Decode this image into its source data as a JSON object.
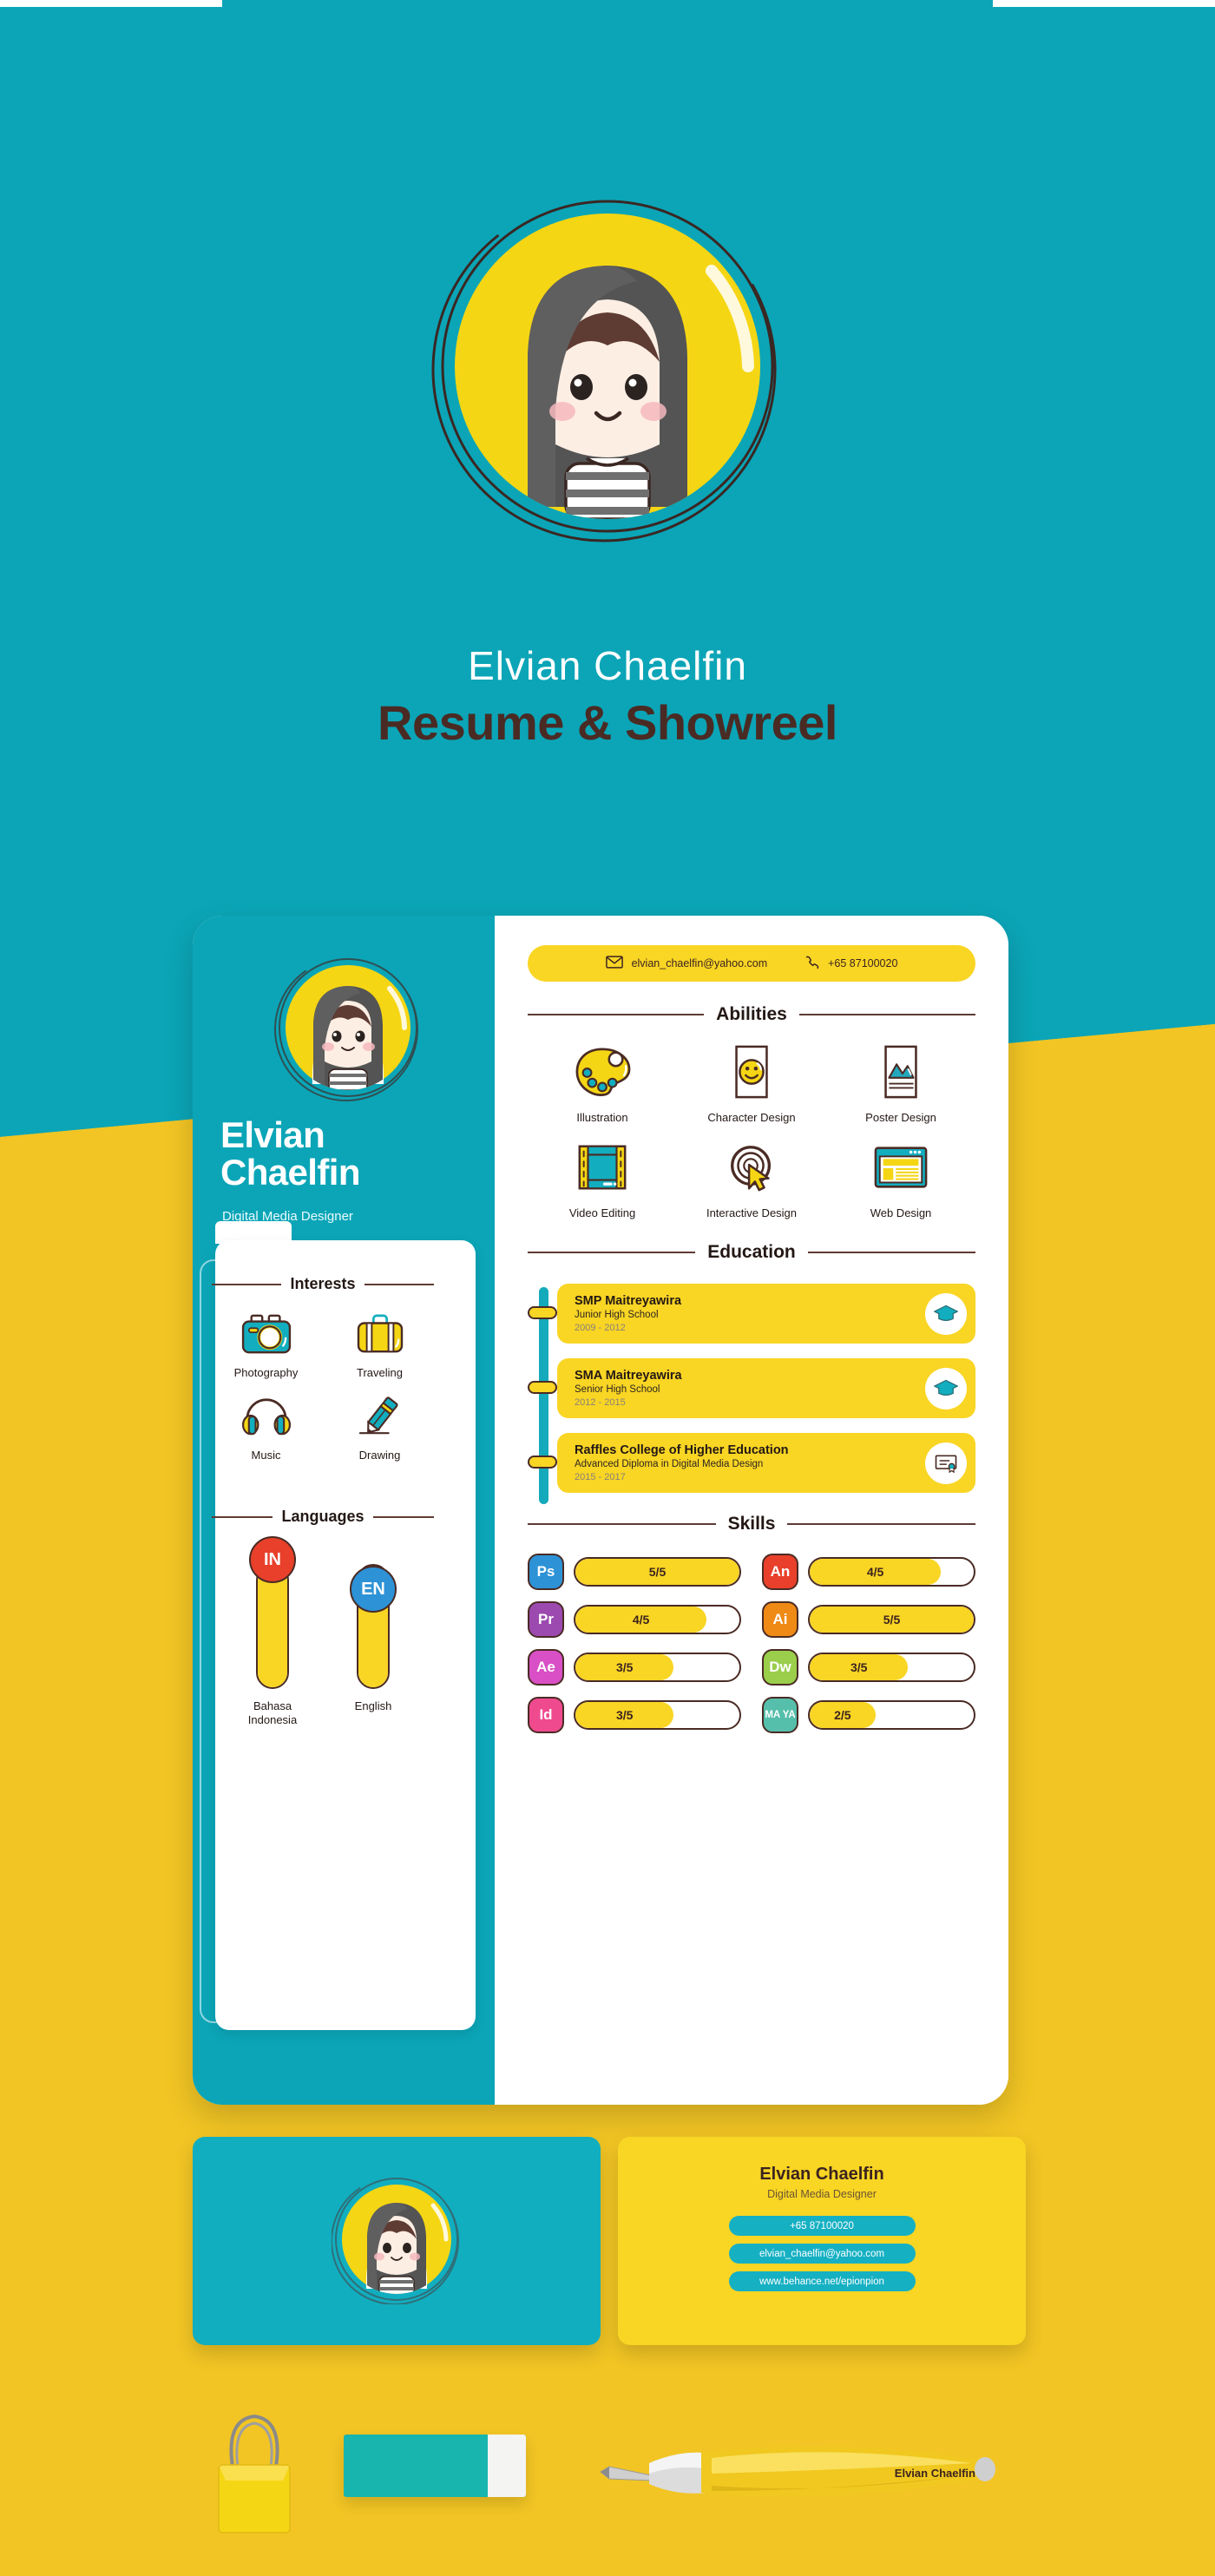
{
  "theme": {
    "teal": "#0ba5b7",
    "yellow": "#f2c524",
    "bright_yellow": "#f9d524",
    "dark_brown": "#4a2b24",
    "white": "#ffffff"
  },
  "hero": {
    "name": "Elvian Chaelfin",
    "title": "Resume & Showreel",
    "avatar_icon": "girl-avatar-icon"
  },
  "resume": {
    "sidebar": {
      "avatar_icon": "girl-avatar-icon",
      "name_line1": "Elvian",
      "name_line2": "Chaelfin",
      "role": "Digital Media Designer",
      "interests": {
        "heading": "Interests",
        "items": [
          {
            "label": "Photography",
            "icon": "camera-icon"
          },
          {
            "label": "Traveling",
            "icon": "suitcase-icon"
          },
          {
            "label": "Music",
            "icon": "headphones-icon"
          },
          {
            "label": "Drawing",
            "icon": "pencil-icon"
          }
        ]
      },
      "languages": {
        "heading": "Languages",
        "items": [
          {
            "code": "IN",
            "name": "Bahasa Indonesia",
            "level": 100,
            "badge_color": "#e8402a"
          },
          {
            "code": "EN",
            "name": "English",
            "level": 78,
            "badge_color": "#2d92d6"
          }
        ]
      }
    },
    "contact": {
      "email": "elvian_chaelfin@yahoo.com",
      "phone": "+65 87100020",
      "email_icon": "envelope-icon",
      "phone_icon": "phone-icon"
    },
    "abilities": {
      "heading": "Abilities",
      "items": [
        {
          "label": "Illustration",
          "icon": "palette-icon"
        },
        {
          "label": "Character Design",
          "icon": "smiley-page-icon"
        },
        {
          "label": "Poster Design",
          "icon": "poster-icon"
        },
        {
          "label": "Video Editing",
          "icon": "film-strip-icon"
        },
        {
          "label": "Interactive Design",
          "icon": "cursor-click-icon"
        },
        {
          "label": "Web Design",
          "icon": "browser-window-icon"
        }
      ]
    },
    "education": {
      "heading": "Education",
      "items": [
        {
          "school": "SMP Maitreyawira",
          "detail": "Junior High School",
          "years": "2009 - 2012",
          "icon": "graduation-cap-icon"
        },
        {
          "school": "SMA Maitreyawira",
          "detail": "Senior High School",
          "years": "2012 - 2015",
          "icon": "graduation-cap-icon"
        },
        {
          "school": "Raffles College of Higher Education",
          "detail": "Advanced Diploma in Digital Media Design",
          "years": "2015 - 2017",
          "icon": "certificate-icon"
        }
      ]
    },
    "skills": {
      "heading": "Skills",
      "items": [
        {
          "code": "Ps",
          "value": "5/5",
          "percent": 100,
          "color": "#2d92d6"
        },
        {
          "code": "An",
          "value": "4/5",
          "percent": 80,
          "color": "#e8402a"
        },
        {
          "code": "Pr",
          "value": "4/5",
          "percent": 80,
          "color": "#9c4ab0"
        },
        {
          "code": "Ai",
          "value": "5/5",
          "percent": 100,
          "color": "#ef8a16"
        },
        {
          "code": "Ae",
          "value": "3/5",
          "percent": 60,
          "color": "#d94fc6"
        },
        {
          "code": "Dw",
          "value": "3/5",
          "percent": 60,
          "color": "#9ace4b"
        },
        {
          "code": "Id",
          "value": "3/5",
          "percent": 60,
          "color": "#f04a8f"
        },
        {
          "code": "MA YA",
          "value": "2/5",
          "percent": 40,
          "color": "#55bfab"
        }
      ]
    }
  },
  "business_card": {
    "front_avatar_icon": "girl-avatar-icon",
    "name": "Elvian Chaelfin",
    "role": "Digital Media Designer",
    "contacts": [
      "+65 87100020",
      "elvian_chaelfin@yahoo.com",
      "www.behance.net/epionpion"
    ]
  },
  "stationery": {
    "clip_icon": "binder-clip-icon",
    "eraser_icon": "eraser-icon",
    "pen_icon": "pen-icon",
    "pen_text": "Elvian Chaelfin"
  }
}
